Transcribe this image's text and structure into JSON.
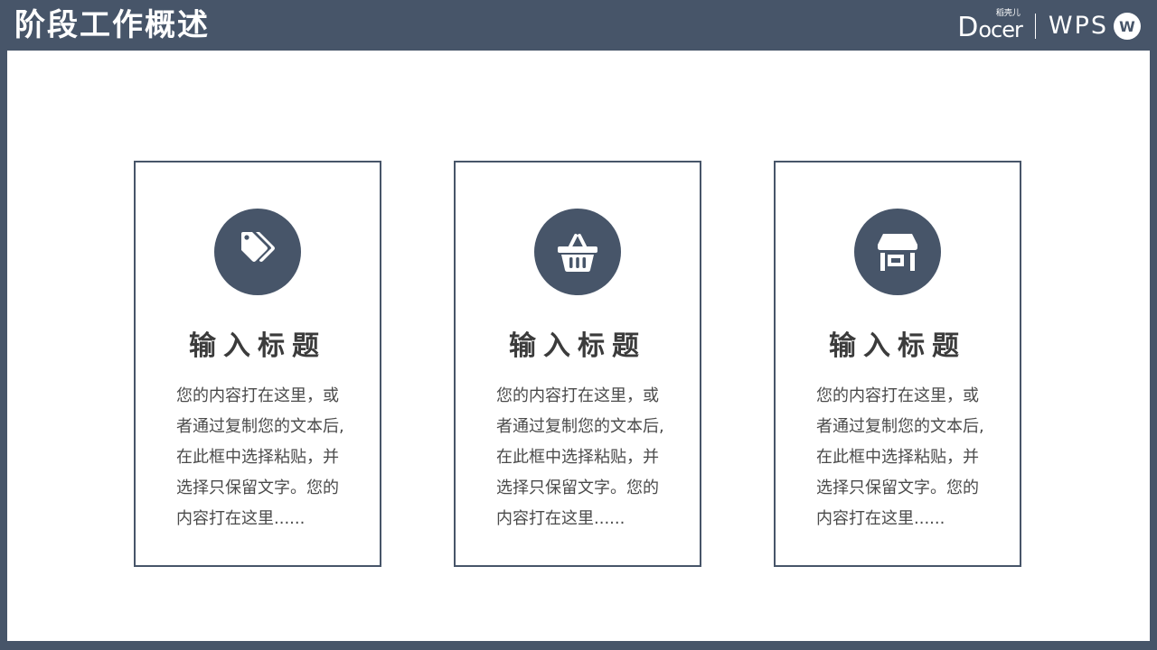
{
  "header": {
    "title": "阶段工作概述",
    "logos": {
      "docer_mark": "D",
      "docer_text": "ocer",
      "docer_small": "稻壳儿",
      "wps_text": "WPS",
      "wps_badge": "W"
    }
  },
  "cards": [
    {
      "icon": "tag-icon",
      "title": "输入标题",
      "body": "您的内容打在这里，或\n者通过复制您的文本后,\n在此框中选择粘贴，并\n选择只保留文字。您的\n内容打在这里......"
    },
    {
      "icon": "basket-icon",
      "title": "输入标题",
      "body": "您的内容打在这里，或\n者通过复制您的文本后,\n在此框中选择粘贴，并\n选择只保留文字。您的\n内容打在这里......"
    },
    {
      "icon": "store-icon",
      "title": "输入标题",
      "body": "您的内容打在这里，或\n者通过复制您的文本后,\n在此框中选择粘贴，并\n选择只保留文字。您的\n内容打在这里......"
    }
  ],
  "colors": {
    "accent": "#475569",
    "background": "#ffffff",
    "text": "#4a4a4a"
  }
}
